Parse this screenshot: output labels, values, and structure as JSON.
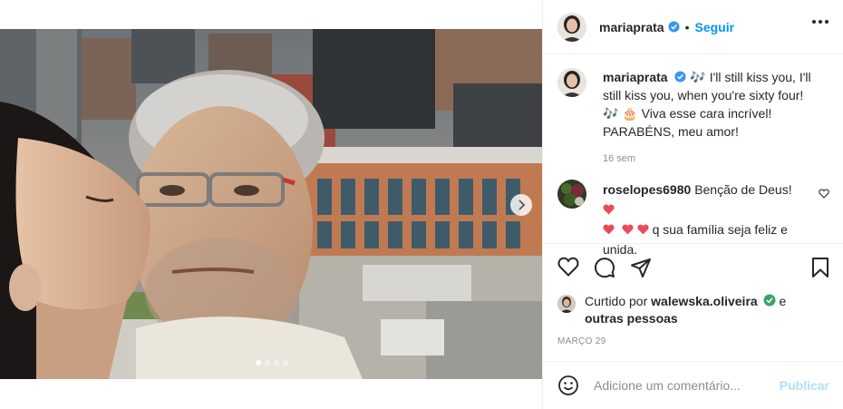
{
  "post": {
    "author": {
      "username": "mariaprata",
      "verified": true,
      "follow_label": "Seguir",
      "separator": "•"
    },
    "media": {
      "slide_count": 4,
      "active_slide": 1,
      "next_icon": "chevron-right-icon"
    },
    "caption": {
      "username": "mariaprata",
      "line1": "🎶 I'll still kiss you, I'll still kiss you, when you're sixty four!",
      "line2": "🎶 🎂 Viva esse cara incrível!",
      "line3": "PARABÉNS, meu amor!",
      "time": "16 sem"
    },
    "comments": [
      {
        "username": "roselopes6980",
        "text_before": "Benção de Deus!",
        "text_after": "q sua família seja feliz e unida.",
        "heart_count_inline": 4
      }
    ],
    "actions": {
      "like_icon": "heart-icon",
      "comment_icon": "comment-icon",
      "share_icon": "share-icon",
      "save_icon": "bookmark-icon"
    },
    "likes": {
      "prefix": "Curtido por",
      "username": "walewska.oliveira",
      "conjunction": "e",
      "others": "outras pessoas"
    },
    "date": "MARÇO 29",
    "add_comment": {
      "placeholder": "Adicione um comentário...",
      "publish_label": "Publicar"
    }
  },
  "colors": {
    "accent": "#0095f6",
    "publish_disabled": "#b2dffc",
    "heart_red": "#ed4956",
    "verified_blue": "#3897f0",
    "muted": "#8e8e8e"
  }
}
